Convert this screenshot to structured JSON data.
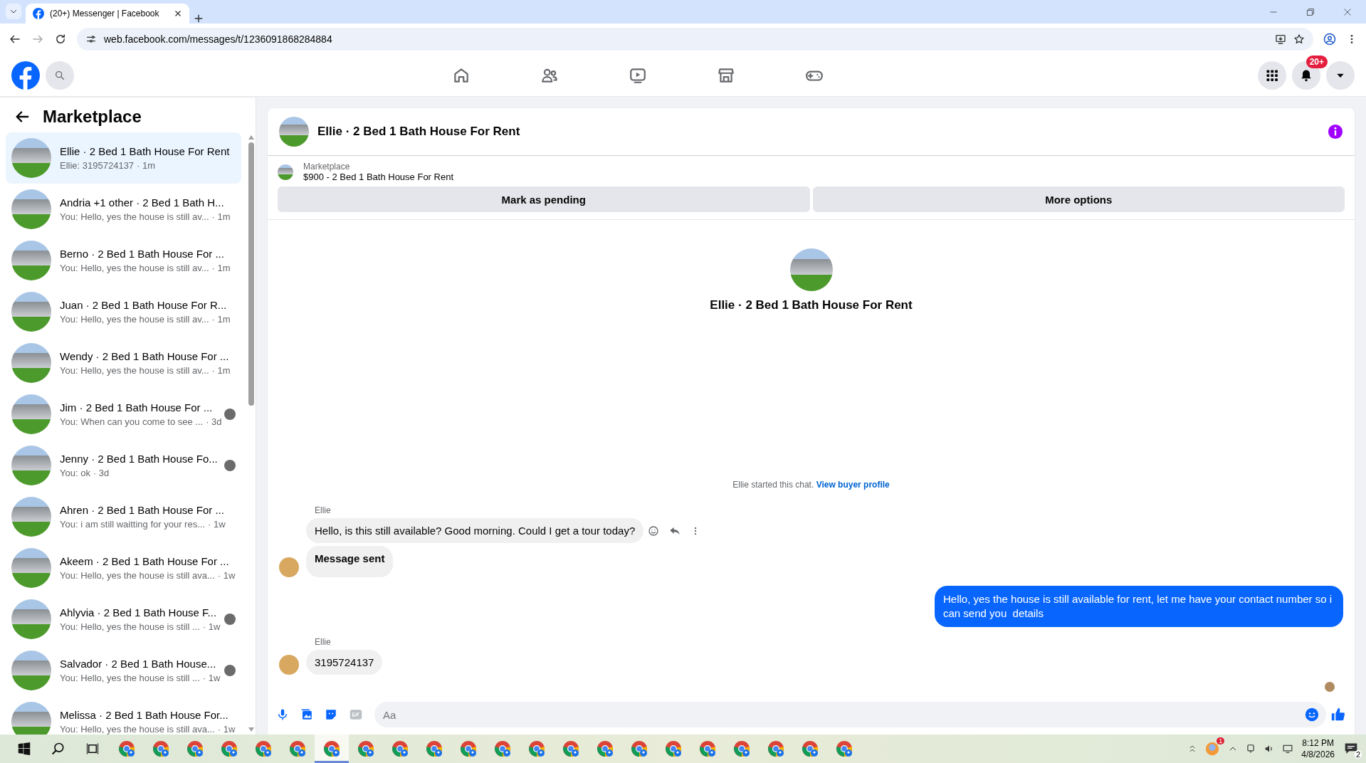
{
  "browser": {
    "tab_title": "(20+) Messenger | Facebook",
    "url": "web.facebook.com/messages/t/1236091868284884"
  },
  "nav": {
    "items": [
      {
        "kind": "home"
      },
      {
        "kind": "friends"
      },
      {
        "kind": "video"
      },
      {
        "kind": "marketplace"
      },
      {
        "kind": "gaming"
      }
    ],
    "notification_badge": "20+"
  },
  "sidebar": {
    "title": "Marketplace",
    "conversations": [
      {
        "title": "Ellie · 2 Bed 1 Bath House For Rent",
        "preview": "Ellie: 3195724137",
        "time": "· 1m",
        "selected": true,
        "read_receipt": false
      },
      {
        "title": "Andria +1 other · 2 Bed 1 Bath H...",
        "preview": "You: Hello, yes the house is still av...",
        "time": "· 1m",
        "selected": false,
        "read_receipt": false
      },
      {
        "title": "Berno · 2 Bed 1 Bath House For ...",
        "preview": "You: Hello, yes the house is still av...",
        "time": "· 1m",
        "selected": false,
        "read_receipt": false
      },
      {
        "title": "Juan · 2 Bed 1 Bath House For R...",
        "preview": "You: Hello, yes the house is still av...",
        "time": "· 1m",
        "selected": false,
        "read_receipt": false
      },
      {
        "title": "Wendy · 2 Bed 1 Bath House For ...",
        "preview": "You: Hello, yes the house is still av...",
        "time": "· 1m",
        "selected": false,
        "read_receipt": false
      },
      {
        "title": "Jim · 2 Bed 1 Bath House For ...",
        "preview": "You: When can you come to see ...",
        "time": "· 3d",
        "selected": false,
        "read_receipt": true
      },
      {
        "title": "Jenny · 2 Bed 1 Bath House Fo...",
        "preview": "You: ok",
        "time": "· 3d",
        "selected": false,
        "read_receipt": true
      },
      {
        "title": "Ahren · 2 Bed 1 Bath House For ...",
        "preview": "You: i am still waitting for your res...",
        "time": "· 1w",
        "selected": false,
        "read_receipt": false
      },
      {
        "title": "Akeem · 2 Bed 1 Bath House For ...",
        "preview": "You: Hello, yes the house is still ava...",
        "time": "· 1w",
        "selected": false,
        "read_receipt": false
      },
      {
        "title": "Ahlyvia · 2 Bed 1 Bath House F...",
        "preview": "You: Hello, yes the house is still ...",
        "time": "· 1w",
        "selected": false,
        "read_receipt": true
      },
      {
        "title": "Salvador · 2 Bed 1 Bath House...",
        "preview": "You: Hello, yes the house is still ...",
        "time": "· 1w",
        "selected": false,
        "read_receipt": true
      },
      {
        "title": "Melissa · 2 Bed 1 Bath House For...",
        "preview": "You: Hello, yes the house is still ava...",
        "time": "· 1w",
        "selected": false,
        "read_receipt": false
      }
    ]
  },
  "chat": {
    "title": "Ellie · 2 Bed 1 Bath House For Rent",
    "listing": {
      "label": "Marketplace",
      "title": "$900 - 2 Bed 1 Bath House For Rent"
    },
    "actions": [
      "Mark as pending",
      "More options"
    ],
    "intro": {
      "name": "Ellie · 2 Bed 1 Bath House For Rent",
      "note": "Ellie started this chat.",
      "link": "View buyer profile"
    },
    "messages": [
      {
        "kind": "incoming",
        "sender": "Ellie",
        "text": "Hello, is this still available? Good morning. Could I get a tour today?",
        "avatar": false,
        "bold": false,
        "hover_actions": true
      },
      {
        "kind": "incoming",
        "text": "Message sent",
        "avatar": true,
        "bold": true,
        "hover_actions": false
      },
      {
        "kind": "outgoing",
        "text": "Hello, yes the house is still available for rent, let me have your contact number so i can send you  details"
      },
      {
        "kind": "incoming",
        "sender": "Ellie",
        "text": "3195724137",
        "avatar": true,
        "bold": false,
        "hover_actions": false
      }
    ],
    "composer": {
      "placeholder": "Aa"
    }
  },
  "taskbar": {
    "apps": [
      {
        "selected": false
      },
      {
        "selected": false
      },
      {
        "selected": false
      },
      {
        "selected": false
      },
      {
        "selected": false
      },
      {
        "selected": false
      },
      {
        "selected": true
      },
      {
        "selected": false
      },
      {
        "selected": false
      },
      {
        "selected": false
      },
      {
        "selected": false
      },
      {
        "selected": false
      },
      {
        "selected": false
      },
      {
        "selected": false
      },
      {
        "selected": false
      },
      {
        "selected": false
      },
      {
        "selected": false
      },
      {
        "selected": false
      },
      {
        "selected": false
      },
      {
        "selected": false
      },
      {
        "selected": false
      },
      {
        "selected": false
      }
    ],
    "tray_badge": "1",
    "time": "8:12 PM",
    "date": "4/8/2026",
    "notifications": "2"
  }
}
